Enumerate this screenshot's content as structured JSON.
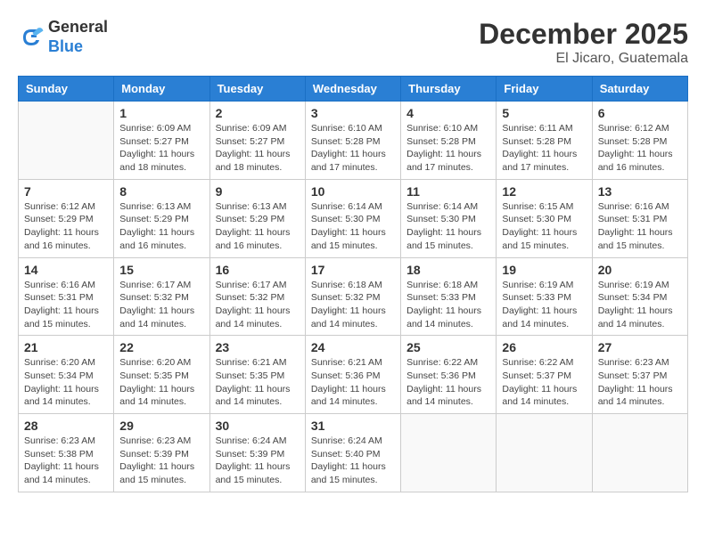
{
  "header": {
    "logo": {
      "line1": "General",
      "line2": "Blue"
    },
    "title": "December 2025",
    "location": "El Jicaro, Guatemala"
  },
  "weekdays": [
    "Sunday",
    "Monday",
    "Tuesday",
    "Wednesday",
    "Thursday",
    "Friday",
    "Saturday"
  ],
  "weeks": [
    [
      {
        "day": "",
        "info": ""
      },
      {
        "day": "1",
        "info": "Sunrise: 6:09 AM\nSunset: 5:27 PM\nDaylight: 11 hours\nand 18 minutes."
      },
      {
        "day": "2",
        "info": "Sunrise: 6:09 AM\nSunset: 5:27 PM\nDaylight: 11 hours\nand 18 minutes."
      },
      {
        "day": "3",
        "info": "Sunrise: 6:10 AM\nSunset: 5:28 PM\nDaylight: 11 hours\nand 17 minutes."
      },
      {
        "day": "4",
        "info": "Sunrise: 6:10 AM\nSunset: 5:28 PM\nDaylight: 11 hours\nand 17 minutes."
      },
      {
        "day": "5",
        "info": "Sunrise: 6:11 AM\nSunset: 5:28 PM\nDaylight: 11 hours\nand 17 minutes."
      },
      {
        "day": "6",
        "info": "Sunrise: 6:12 AM\nSunset: 5:28 PM\nDaylight: 11 hours\nand 16 minutes."
      }
    ],
    [
      {
        "day": "7",
        "info": "Sunrise: 6:12 AM\nSunset: 5:29 PM\nDaylight: 11 hours\nand 16 minutes."
      },
      {
        "day": "8",
        "info": "Sunrise: 6:13 AM\nSunset: 5:29 PM\nDaylight: 11 hours\nand 16 minutes."
      },
      {
        "day": "9",
        "info": "Sunrise: 6:13 AM\nSunset: 5:29 PM\nDaylight: 11 hours\nand 16 minutes."
      },
      {
        "day": "10",
        "info": "Sunrise: 6:14 AM\nSunset: 5:30 PM\nDaylight: 11 hours\nand 15 minutes."
      },
      {
        "day": "11",
        "info": "Sunrise: 6:14 AM\nSunset: 5:30 PM\nDaylight: 11 hours\nand 15 minutes."
      },
      {
        "day": "12",
        "info": "Sunrise: 6:15 AM\nSunset: 5:30 PM\nDaylight: 11 hours\nand 15 minutes."
      },
      {
        "day": "13",
        "info": "Sunrise: 6:16 AM\nSunset: 5:31 PM\nDaylight: 11 hours\nand 15 minutes."
      }
    ],
    [
      {
        "day": "14",
        "info": "Sunrise: 6:16 AM\nSunset: 5:31 PM\nDaylight: 11 hours\nand 15 minutes."
      },
      {
        "day": "15",
        "info": "Sunrise: 6:17 AM\nSunset: 5:32 PM\nDaylight: 11 hours\nand 14 minutes."
      },
      {
        "day": "16",
        "info": "Sunrise: 6:17 AM\nSunset: 5:32 PM\nDaylight: 11 hours\nand 14 minutes."
      },
      {
        "day": "17",
        "info": "Sunrise: 6:18 AM\nSunset: 5:32 PM\nDaylight: 11 hours\nand 14 minutes."
      },
      {
        "day": "18",
        "info": "Sunrise: 6:18 AM\nSunset: 5:33 PM\nDaylight: 11 hours\nand 14 minutes."
      },
      {
        "day": "19",
        "info": "Sunrise: 6:19 AM\nSunset: 5:33 PM\nDaylight: 11 hours\nand 14 minutes."
      },
      {
        "day": "20",
        "info": "Sunrise: 6:19 AM\nSunset: 5:34 PM\nDaylight: 11 hours\nand 14 minutes."
      }
    ],
    [
      {
        "day": "21",
        "info": "Sunrise: 6:20 AM\nSunset: 5:34 PM\nDaylight: 11 hours\nand 14 minutes."
      },
      {
        "day": "22",
        "info": "Sunrise: 6:20 AM\nSunset: 5:35 PM\nDaylight: 11 hours\nand 14 minutes."
      },
      {
        "day": "23",
        "info": "Sunrise: 6:21 AM\nSunset: 5:35 PM\nDaylight: 11 hours\nand 14 minutes."
      },
      {
        "day": "24",
        "info": "Sunrise: 6:21 AM\nSunset: 5:36 PM\nDaylight: 11 hours\nand 14 minutes."
      },
      {
        "day": "25",
        "info": "Sunrise: 6:22 AM\nSunset: 5:36 PM\nDaylight: 11 hours\nand 14 minutes."
      },
      {
        "day": "26",
        "info": "Sunrise: 6:22 AM\nSunset: 5:37 PM\nDaylight: 11 hours\nand 14 minutes."
      },
      {
        "day": "27",
        "info": "Sunrise: 6:23 AM\nSunset: 5:37 PM\nDaylight: 11 hours\nand 14 minutes."
      }
    ],
    [
      {
        "day": "28",
        "info": "Sunrise: 6:23 AM\nSunset: 5:38 PM\nDaylight: 11 hours\nand 14 minutes."
      },
      {
        "day": "29",
        "info": "Sunrise: 6:23 AM\nSunset: 5:39 PM\nDaylight: 11 hours\nand 15 minutes."
      },
      {
        "day": "30",
        "info": "Sunrise: 6:24 AM\nSunset: 5:39 PM\nDaylight: 11 hours\nand 15 minutes."
      },
      {
        "day": "31",
        "info": "Sunrise: 6:24 AM\nSunset: 5:40 PM\nDaylight: 11 hours\nand 15 minutes."
      },
      {
        "day": "",
        "info": ""
      },
      {
        "day": "",
        "info": ""
      },
      {
        "day": "",
        "info": ""
      }
    ]
  ]
}
